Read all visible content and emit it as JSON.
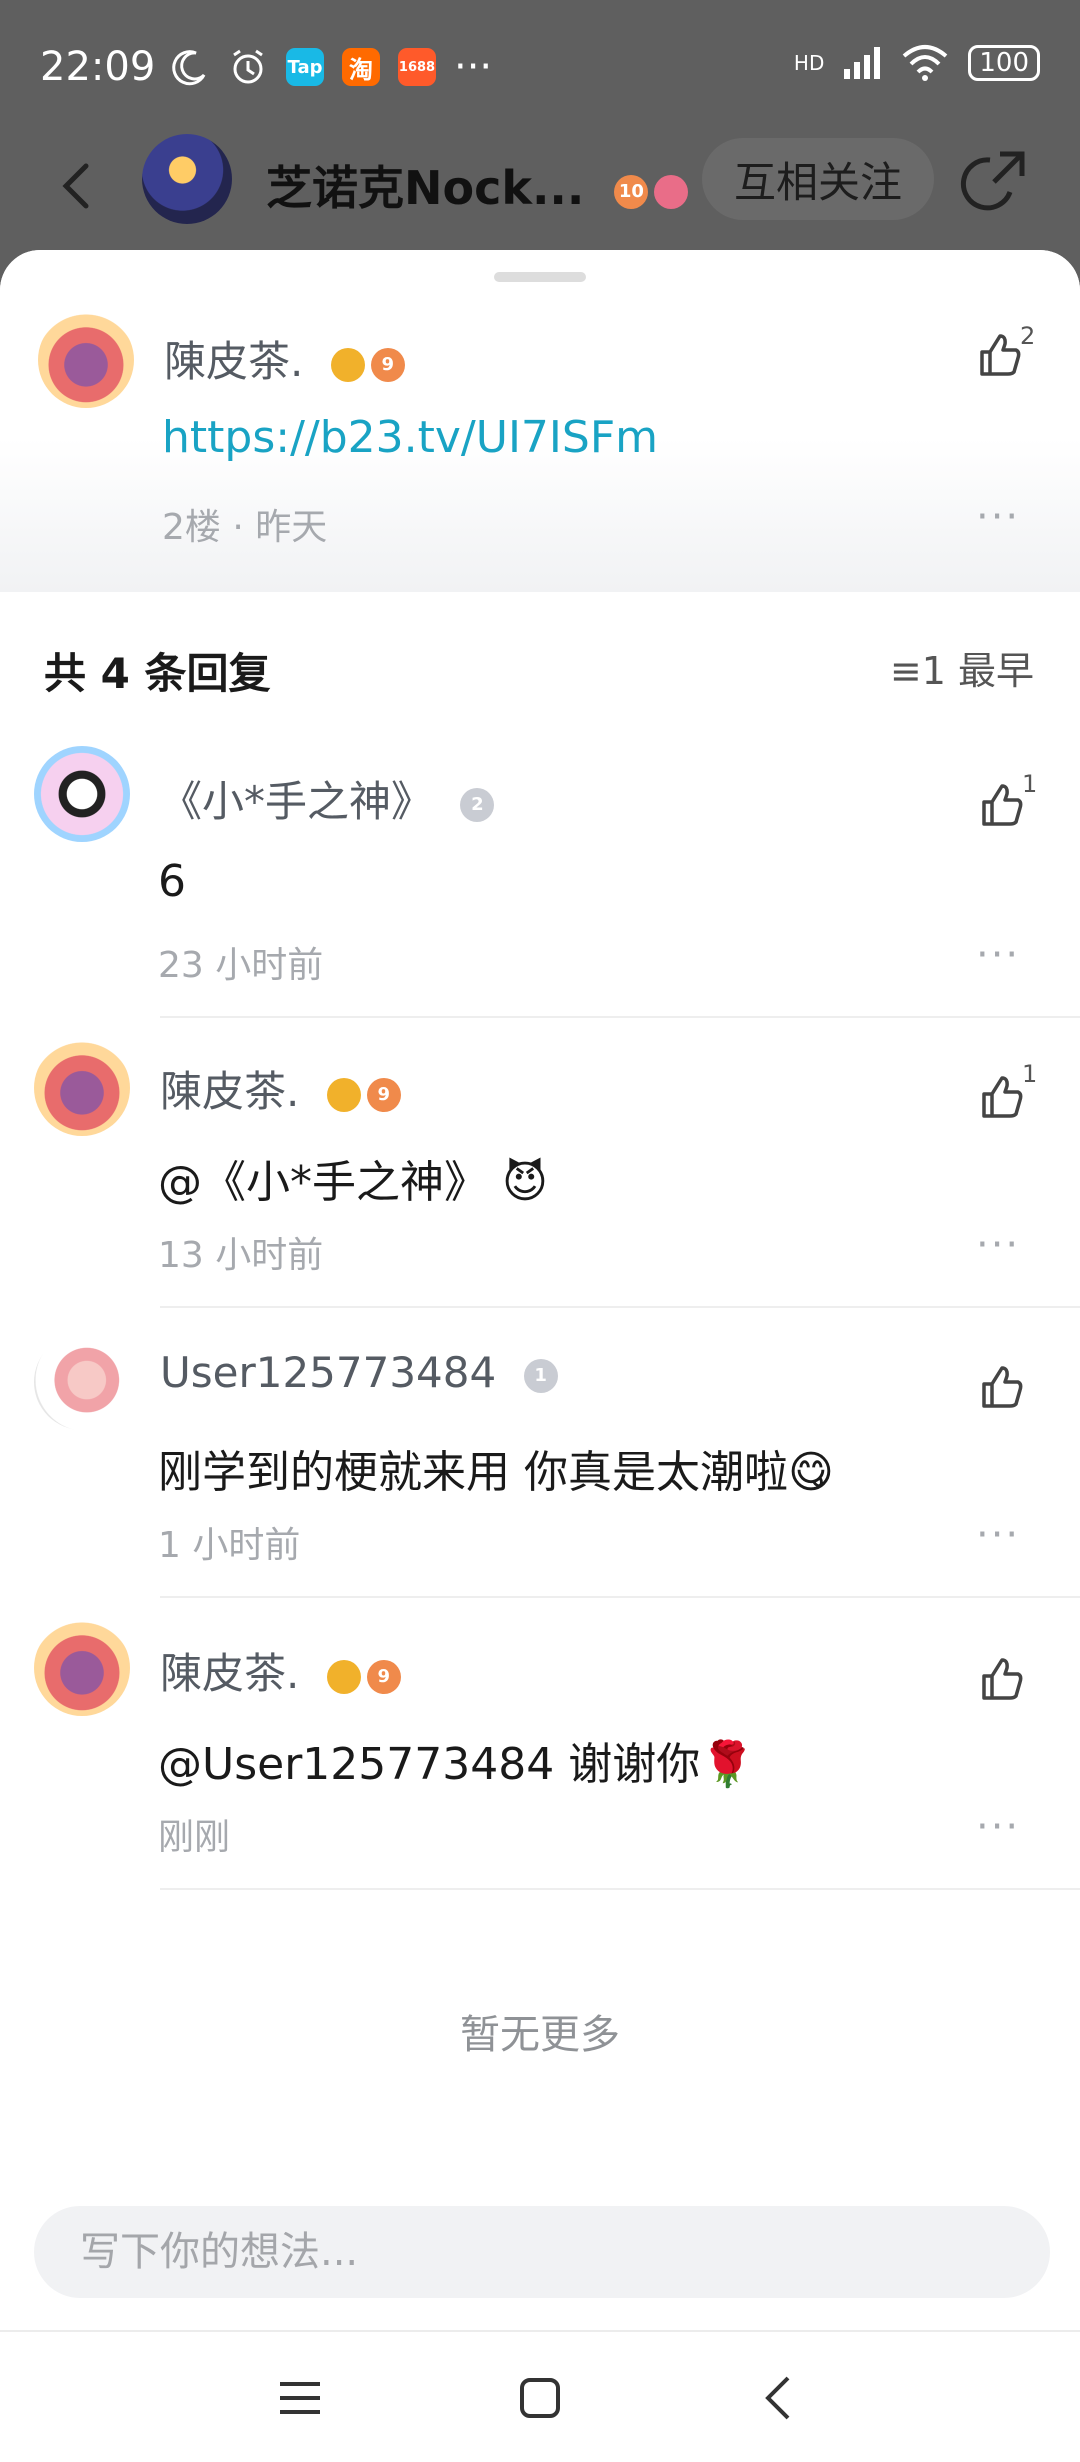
{
  "status_bar": {
    "time": "22:09",
    "icons": [
      "moon-icon",
      "alarm-icon",
      "taptap-app-icon",
      "taobao-app-icon",
      "1688-app-icon",
      "more-dots"
    ],
    "tap_label": "Tap",
    "taobao_label": "淘",
    "alibaba_label": "1688",
    "dots": "···",
    "network": "HD",
    "battery": "100"
  },
  "header": {
    "title": "芝诺克Nock...",
    "badge_level": "10",
    "follow_label": "互相关注"
  },
  "root_comment": {
    "user": "陳皮茶.",
    "level": "9",
    "link": "https://b23.tv/UI7ISFm",
    "meta": "2楼 · 昨天",
    "likes": "2",
    "more": "···"
  },
  "replies_header": {
    "title": "共 4 条回复",
    "sort_icon": "≡1",
    "sort_label": "最早"
  },
  "replies": [
    {
      "user": "《小*手之神》",
      "level": "2",
      "text": "6",
      "time": "23 小时前",
      "likes": "1",
      "more": "···"
    },
    {
      "user": "陳皮茶.",
      "level": "9",
      "text": "@《小*手之神》  😈",
      "time": "13 小时前",
      "likes": "1",
      "more": "···"
    },
    {
      "user": "User125773484",
      "level": "1",
      "text": "刚学到的梗就来用 你真是太潮啦😋",
      "time": "1 小时前",
      "likes": "",
      "more": "···"
    },
    {
      "user": "陳皮茶.",
      "level": "9",
      "text": "@User125773484  谢谢你🌹",
      "time": "刚刚",
      "likes": "",
      "more": "···"
    }
  ],
  "no_more": "暂无更多",
  "input": {
    "placeholder": "写下你的想法..."
  },
  "colors": {
    "link": "#19a3c4",
    "accent_gold": "#f1b12b",
    "accent_orange": "#f08a4b"
  }
}
